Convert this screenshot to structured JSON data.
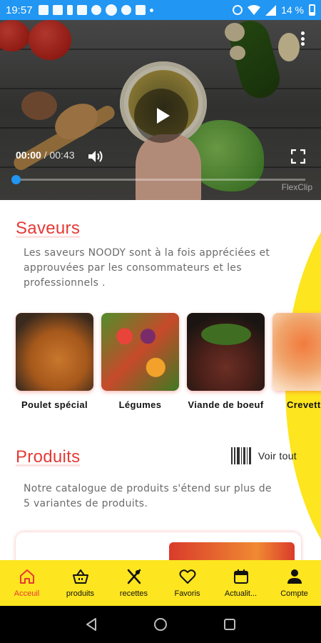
{
  "status_bar": {
    "time": "19:57",
    "battery_percent": "14 %",
    "icons": [
      "m-icon",
      "m-icon",
      "battery-saver-icon",
      "instagram-icon",
      "bell-icon",
      "circle-icon",
      "bell-icon",
      "square-icon",
      "dot-icon",
      "alarm-icon",
      "wifi-icon",
      "signal-icon",
      "battery-icon"
    ]
  },
  "video": {
    "current_time": "00:00",
    "separator": " / ",
    "duration": "00:43",
    "progress": 0,
    "watermark": "FlexClip"
  },
  "saveurs": {
    "title": "Saveurs",
    "description": "Les saveurs NOODY sont à la fois appréciées  et approuvées par les consommateurs et les professionnels .",
    "items": [
      {
        "label": "Poulet  spécial"
      },
      {
        "label": "Légumes"
      },
      {
        "label": "Viande  de boeuf"
      },
      {
        "label": "Crevettes"
      }
    ]
  },
  "produits": {
    "title": "Produits",
    "voir_tout": "Voir tout",
    "description": "Notre catalogue de produits s'étend sur plus de 5 variantes de produits."
  },
  "bottom_nav": {
    "items": [
      {
        "label": "Acceuil",
        "icon": "home-icon",
        "active": true
      },
      {
        "label": "produits",
        "icon": "basket-icon",
        "active": false
      },
      {
        "label": "recettes",
        "icon": "utensils-icon",
        "active": false
      },
      {
        "label": "Favoris",
        "icon": "heart-icon",
        "active": false
      },
      {
        "label": "Actualit...",
        "icon": "calendar-icon",
        "active": false
      },
      {
        "label": "Compte",
        "icon": "person-icon",
        "active": false
      }
    ]
  },
  "colors": {
    "accent_red": "#e53935",
    "brand_yellow": "#FDE51F",
    "status_blue": "#2196F3"
  }
}
